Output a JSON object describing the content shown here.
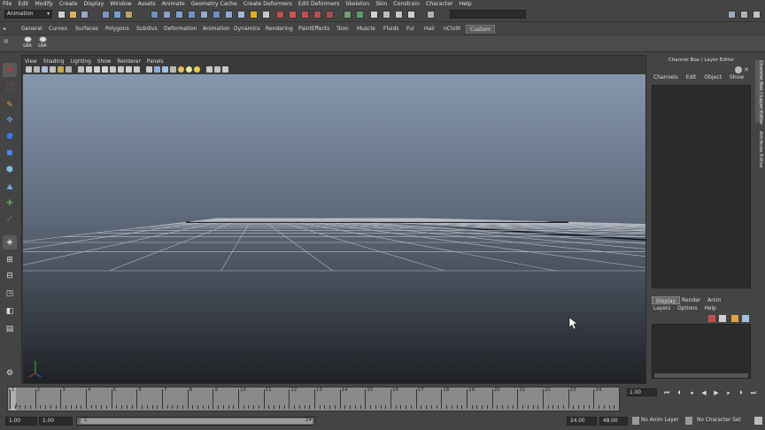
{
  "menubar": [
    "File",
    "Edit",
    "Modify",
    "Create",
    "Display",
    "Window",
    "Assets",
    "Animate",
    "Geometry Cache",
    "Create Deformers",
    "Edit Deformers",
    "Skeleton",
    "Skin",
    "Constrain",
    "Character",
    "Help"
  ],
  "statusline": {
    "mode": "Animation"
  },
  "shelf": {
    "tabs": [
      "General",
      "Curves",
      "Surfaces",
      "Polygons",
      "Subdivs",
      "Deformation",
      "Animation",
      "Dynamics",
      "Rendering",
      "PaintEffects",
      "Toon",
      "Muscle",
      "Fluids",
      "Fur",
      "Hair",
      "nCloth",
      "Custom"
    ],
    "active_tab": "Custom",
    "buttons": [
      "LRA",
      "LRA"
    ]
  },
  "panel": {
    "menu": [
      "View",
      "Shading",
      "Lighting",
      "Show",
      "Renderer",
      "Panels"
    ]
  },
  "channelbox": {
    "title": "Channel Box / Layer Editor",
    "menu": [
      "Channels",
      "Edit",
      "Object",
      "Show"
    ]
  },
  "side_tabs": [
    "Channel Box / Layer Editor",
    "Attribute Editor"
  ],
  "layers": {
    "tabs": [
      "Display",
      "Render",
      "Anim"
    ],
    "active_tab": "Display",
    "menu": [
      "Layers",
      "Options",
      "Help"
    ]
  },
  "timeline": {
    "ticks": [
      "1",
      "2",
      "3",
      "4",
      "5",
      "6",
      "7",
      "8",
      "9",
      "10",
      "11",
      "12",
      "13",
      "14",
      "15",
      "16",
      "17",
      "18",
      "19",
      "20",
      "21",
      "22",
      "23",
      "24"
    ],
    "current_frame_marker": "1",
    "current_frame": "1.00"
  },
  "range": {
    "start": "1.00",
    "anim_start": "1.00",
    "handle_start": "1",
    "handle_end": "24",
    "end": "24.00",
    "anim_end": "48.00",
    "anim_layer": "No Anim Layer",
    "character_set": "No Character Set"
  }
}
